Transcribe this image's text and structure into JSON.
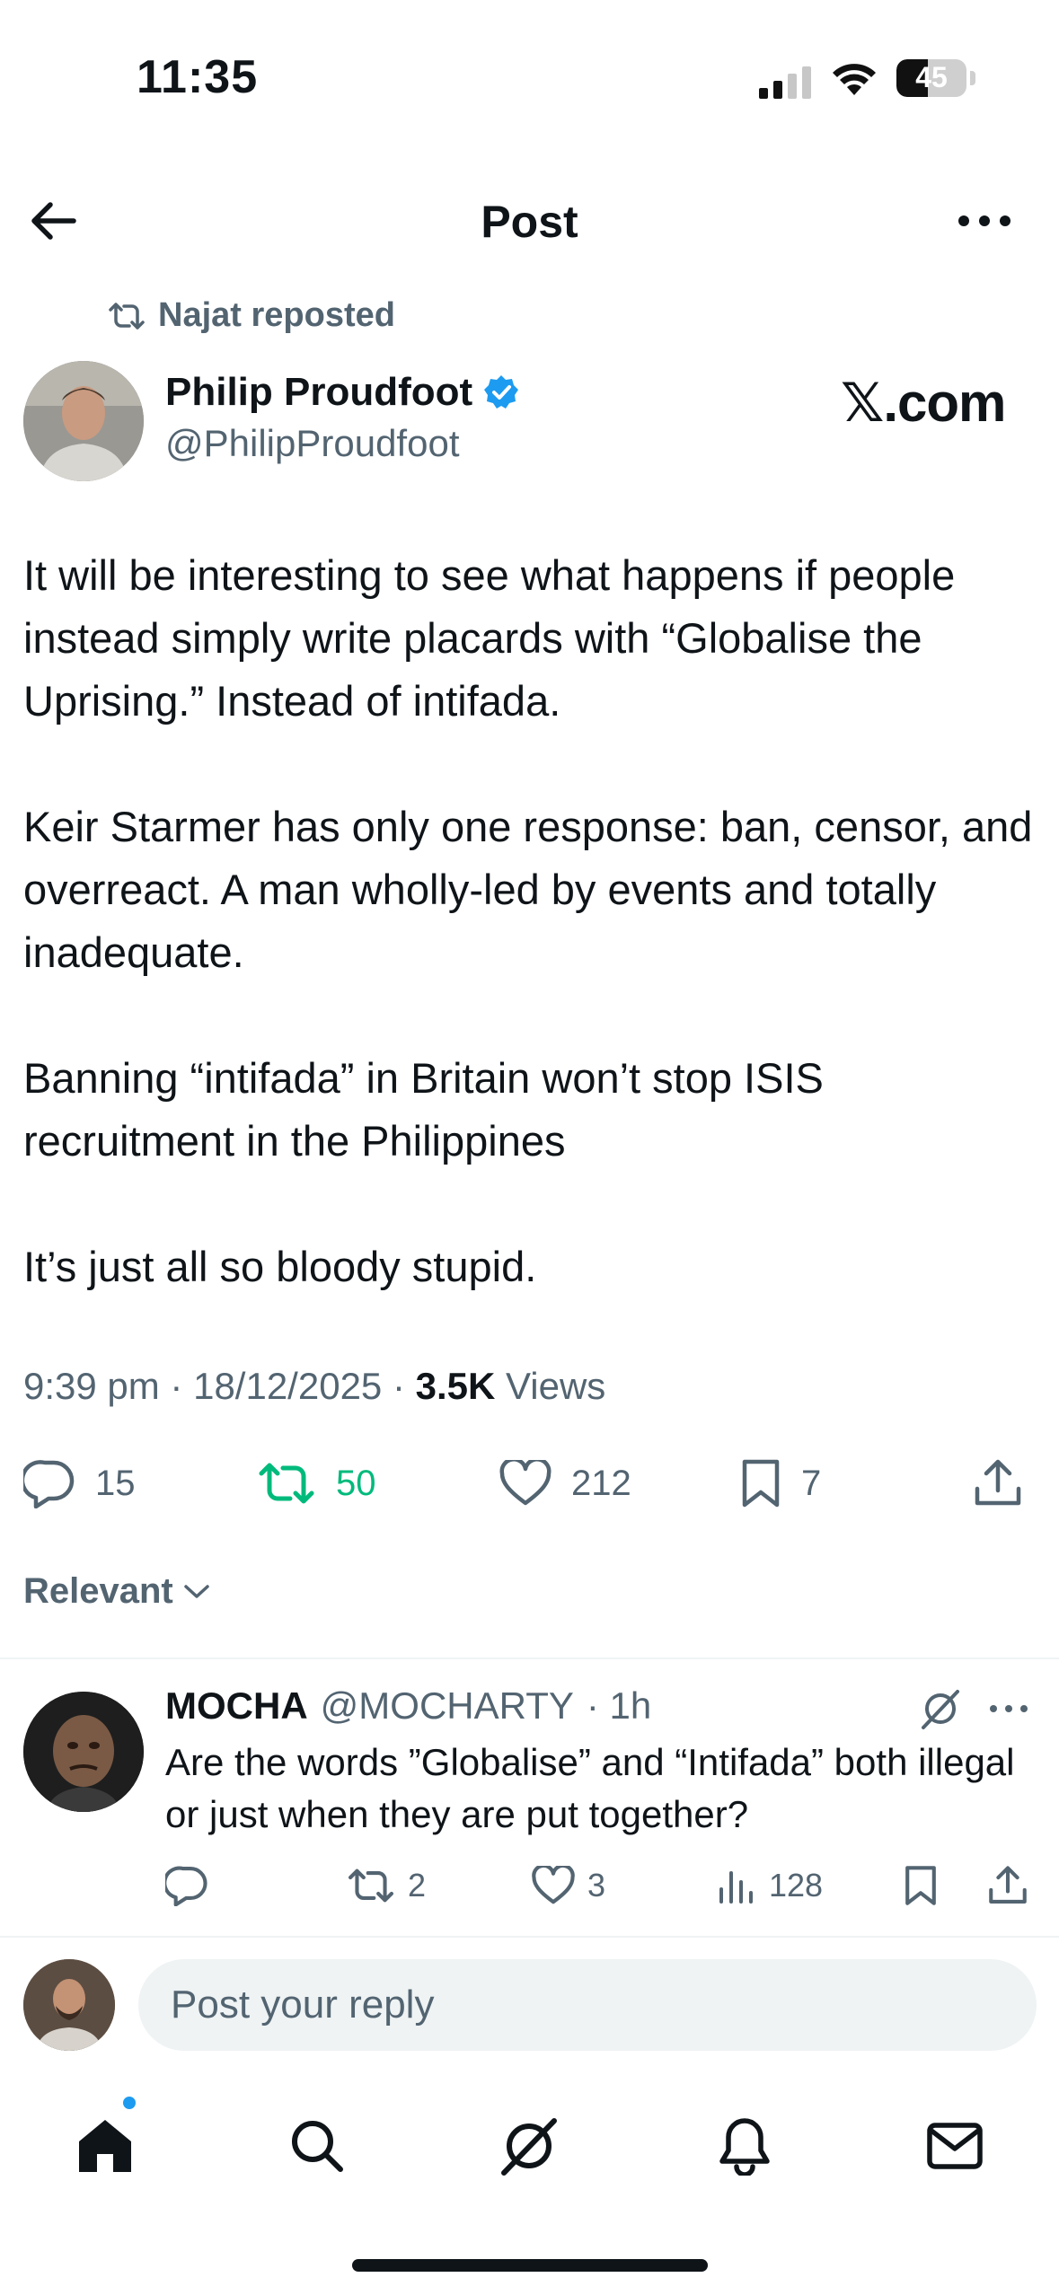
{
  "status_bar": {
    "time": "11:35",
    "battery_level": "45",
    "battery_fraction": 0.45
  },
  "header": {
    "title": "Post"
  },
  "repost": {
    "text": "Najat reposted"
  },
  "author": {
    "name": "Philip Proudfoot",
    "handle": "@PhilipProudfoot",
    "verified": true,
    "badge_color": "#1d9bf0"
  },
  "watermark": "𝕏.com",
  "post": {
    "paragraphs": [
      "It will be interesting to see what happens if people instead simply write placards with “Globalise the Uprising.” Instead of intifada.",
      "Keir Starmer has only one response: ban, censor, and overreact. A man wholly-led by events and totally inadequate.",
      "Banning “intifada” in Britain won’t stop ISIS recruitment in the Philippines",
      "It’s just all so bloody stupid."
    ],
    "timestamp": "9:39 pm · 18/12/2025 · ",
    "views_count": "3.5K",
    "views_label": " Views"
  },
  "actions": {
    "replies": "15",
    "reposts": "50",
    "likes": "212",
    "bookmarks": "7",
    "repost_active_color": "#00ba7c"
  },
  "sort": {
    "label": "Relevant"
  },
  "reply": {
    "name": "MOCHA",
    "handle": "@MOCHARTY",
    "time": "· 1h",
    "text": "Are the words ”Globalise” and “Intifada” both illegal or just when they are put together?",
    "replies": "",
    "reposts": "2",
    "likes": "3",
    "views": "128"
  },
  "compose": {
    "placeholder": "Post your reply"
  },
  "icons": {
    "back": "arrow-left-icon",
    "more": "more-horizontal-icon",
    "repost": "repost-icon",
    "verified": "verified-badge-icon",
    "reply": "reply-icon",
    "like": "heart-icon",
    "bookmark": "bookmark-icon",
    "share": "share-icon",
    "views": "views-icon",
    "grok": "grok-icon",
    "home": "home-icon",
    "search": "search-icon",
    "notifications": "bell-icon",
    "messages": "mail-icon"
  }
}
